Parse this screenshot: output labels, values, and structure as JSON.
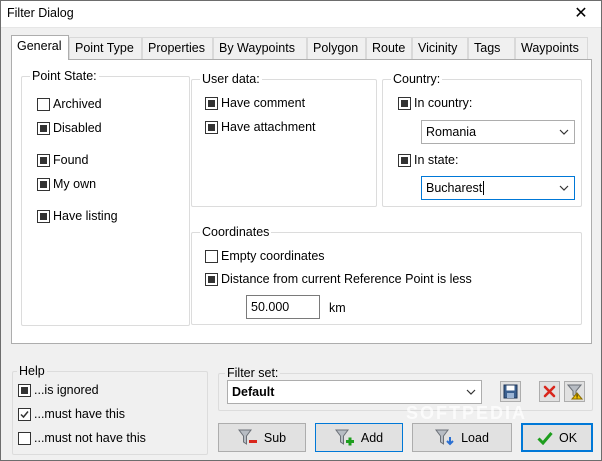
{
  "window": {
    "title": "Filter Dialog",
    "close_glyph": "✕"
  },
  "tabs": [
    {
      "label": "General"
    },
    {
      "label": "Point Type"
    },
    {
      "label": "Properties"
    },
    {
      "label": "By Waypoints"
    },
    {
      "label": "Polygon"
    },
    {
      "label": "Route"
    },
    {
      "label": "Vicinity"
    },
    {
      "label": "Tags"
    },
    {
      "label": "Waypoints"
    }
  ],
  "point_state": {
    "title": "Point State:",
    "items": [
      {
        "label": "Archived",
        "state": "unchecked"
      },
      {
        "label": "Disabled",
        "state": "indeterminate"
      },
      {
        "label": "Found",
        "state": "indeterminate"
      },
      {
        "label": "My own",
        "state": "indeterminate"
      },
      {
        "label": "Have listing",
        "state": "indeterminate"
      }
    ]
  },
  "user_data": {
    "title": "User data:",
    "items": [
      {
        "label": "Have comment",
        "state": "indeterminate"
      },
      {
        "label": "Have attachment",
        "state": "indeterminate"
      }
    ]
  },
  "country": {
    "title": "Country:",
    "in_country": {
      "label": "In country:",
      "state": "indeterminate",
      "value": "Romania"
    },
    "in_state": {
      "label": "In state:",
      "state": "indeterminate",
      "value": "Bucharest"
    }
  },
  "coordinates": {
    "title": "Coordinates",
    "empty": {
      "label": "Empty coordinates",
      "state": "unchecked"
    },
    "distance": {
      "label": "Distance from current Reference Point is less",
      "state": "indeterminate"
    },
    "distance_value": "50.000",
    "unit": "km"
  },
  "help": {
    "title": "Help",
    "items": [
      {
        "label": "...is ignored",
        "state": "indeterminate"
      },
      {
        "label": "...must have this",
        "state": "checked"
      },
      {
        "label": "...must not have this",
        "state": "unchecked"
      }
    ]
  },
  "filter_set": {
    "label": "Filter set:",
    "value": "Default"
  },
  "buttons": {
    "sub": "Sub",
    "add": "Add",
    "load": "Load",
    "ok": "OK"
  },
  "colors": {
    "accent": "#0078d7",
    "ok_check": "#1e9e1e",
    "delete_red": "#d9261c"
  },
  "watermark": "SOFTPEDIA"
}
